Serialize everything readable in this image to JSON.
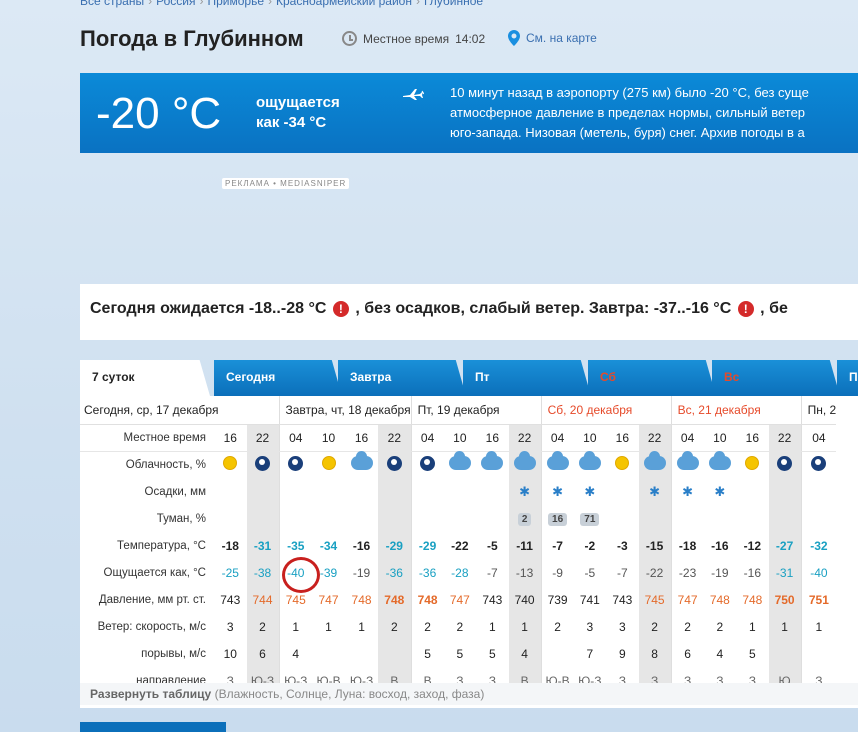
{
  "breadcrumb": [
    "Все страны",
    "Россия",
    "Приморье",
    "Красноармейский район",
    "Глубинное"
  ],
  "page_title": "Погода в Глубинном",
  "local_time": {
    "label": "Местное время",
    "value": "14:02"
  },
  "map_link": "См. на карте",
  "banner": {
    "temp": "-20 °C",
    "feels_line1": "ощущается",
    "feels_line2": "как -34 °C",
    "airport_lines": [
      "10 минут назад в аэропорту (275 км) было -20 °C, без суще",
      "атмосферное давление в пределах нормы, сильный ветер",
      "юго-запада. Низовая (метель, буря) снег. Архив погоды в а"
    ]
  },
  "ad_label": "РЕКЛАМА • MEDIASNIPER",
  "summary": {
    "part1": "Сегодня ожидается -18..-28 °C",
    "part2": ", без осадков, слабый ветер. Завтра: -37..-16 °C",
    "part3": ", бе"
  },
  "tabs": [
    {
      "label": "7 суток",
      "active": true
    },
    {
      "label": "Сегодня"
    },
    {
      "label": "Завтра"
    },
    {
      "label": "Пт"
    },
    {
      "label": "Сб",
      "red": true
    },
    {
      "label": "Вс",
      "red": true
    },
    {
      "label": "П"
    }
  ],
  "days": [
    {
      "label": "Сегодня, ср, 17 декабря"
    },
    {
      "label": "Завтра, чт, 18 декабря"
    },
    {
      "label": "Пт, 19 декабря"
    },
    {
      "label": "Сб, 20 декабря",
      "red": true
    },
    {
      "label": "Вс, 21 декабря",
      "red": true
    },
    {
      "label": "Пн, 2"
    }
  ],
  "row_labels": {
    "hours": "Местное время",
    "cloud": "Облачность, %",
    "precip": "Осадки, мм",
    "fog": "Туман, %",
    "temp": "Температура, °C",
    "feels": "Ощущается как, °C",
    "pressure": "Давление, мм рт. ст.",
    "wind": "Ветер: скорость, м/с",
    "gusts": "порывы, м/с",
    "direction": "направление"
  },
  "hours": [
    "16",
    "22",
    "04",
    "10",
    "16",
    "22",
    "04",
    "10",
    "16",
    "22",
    "04",
    "10",
    "16",
    "22",
    "04",
    "10",
    "16",
    "22",
    "04"
  ],
  "cloud_icons": [
    "sun-icon",
    "moon-icon",
    "moon-icon",
    "sun-icon",
    "cloud-icon",
    "moon-icon",
    "moon-icon",
    "cloud-icon",
    "cloud-icon",
    "cloud-icon",
    "cloud-icon",
    "cloud-icon",
    "sun-icon",
    "cloud-icon",
    "cloud-icon",
    "cloud-icon",
    "sun-icon",
    "moon-icon",
    "moon-icon"
  ],
  "precip": [
    "",
    "",
    "",
    "",
    "",
    "",
    "",
    "",
    "",
    "*",
    "*",
    "*",
    "",
    "*",
    "*",
    "*",
    "",
    "",
    ""
  ],
  "fog": [
    "",
    "",
    "",
    "",
    "",
    "",
    "",
    "",
    "",
    "2",
    "16",
    "71",
    "",
    "",
    "",
    "",
    "",
    "",
    ""
  ],
  "temps": [
    "-18",
    "-31",
    "-35",
    "-34",
    "-16",
    "-29",
    "-29",
    "-22",
    "-5",
    "-11",
    "-7",
    "-2",
    "-3",
    "-15",
    "-18",
    "-16",
    "-12",
    "-27",
    "-32"
  ],
  "feels": [
    "-25",
    "-38",
    "-40",
    "-39",
    "-19",
    "-36",
    "-36",
    "-28",
    "-7",
    "-13",
    "-9",
    "-5",
    "-7",
    "-22",
    "-23",
    "-19",
    "-16",
    "-31",
    "-40"
  ],
  "pressure": [
    "743",
    "744",
    "745",
    "747",
    "748",
    "748",
    "748",
    "747",
    "743",
    "740",
    "739",
    "741",
    "743",
    "745",
    "747",
    "748",
    "748",
    "750",
    "751"
  ],
  "wind": [
    "3",
    "2",
    "1",
    "1",
    "1",
    "2",
    "2",
    "2",
    "1",
    "1",
    "2",
    "3",
    "3",
    "2",
    "2",
    "2",
    "1",
    "1",
    "1"
  ],
  "gusts": [
    "10",
    "6",
    "4",
    "",
    "",
    "",
    "5",
    "5",
    "5",
    "4",
    "",
    "7",
    "9",
    "8",
    "6",
    "4",
    "5",
    "",
    ""
  ],
  "direction": [
    "З",
    "Ю-З",
    "Ю-З",
    "Ю-В",
    "Ю-З",
    "В",
    "В",
    "З",
    "З",
    "В",
    "Ю-В",
    "Ю-З",
    "З",
    "З",
    "З",
    "З",
    "З",
    "Ю",
    "З"
  ],
  "expand": {
    "link": "Развернуть таблицу",
    "hint": " (Влажность, Солнце, Луна: восход, заход, фаза)"
  }
}
